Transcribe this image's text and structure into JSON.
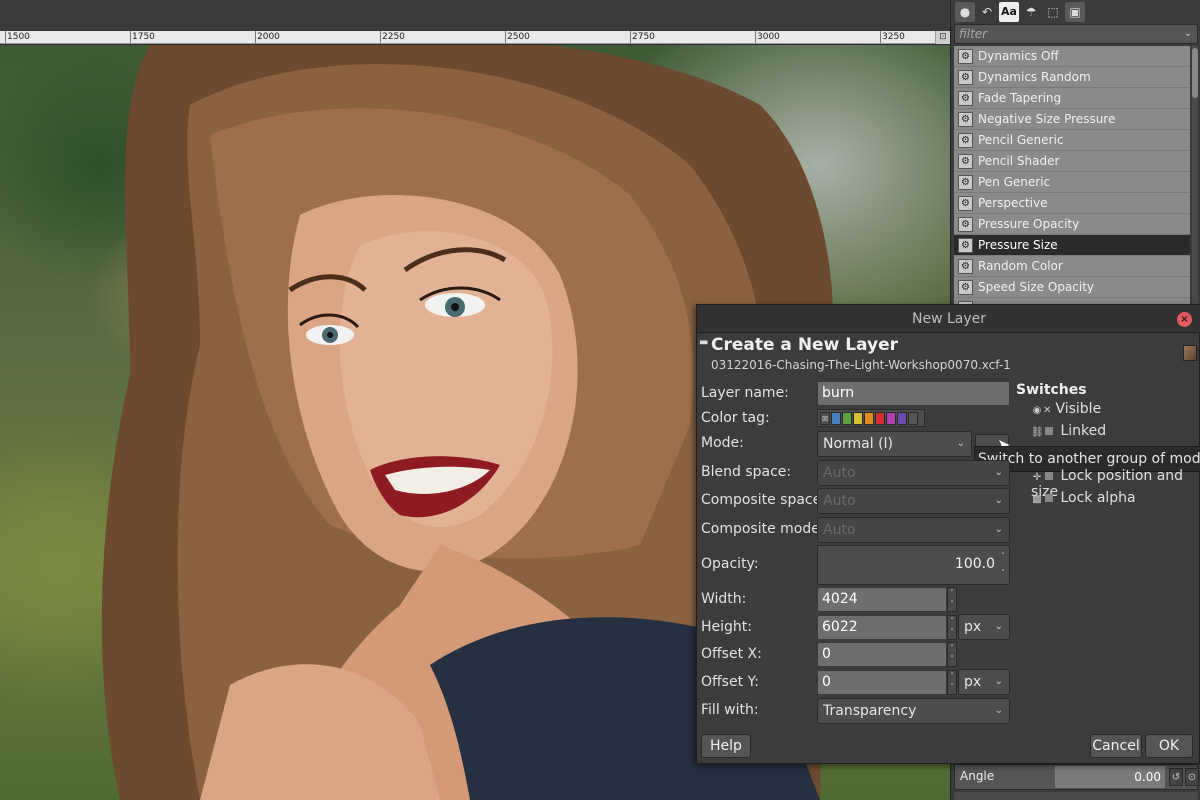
{
  "ruler": {
    "labels": [
      "1500",
      "1750",
      "2000",
      "2250",
      "2500",
      "2750",
      "3000",
      "3250"
    ],
    "corner_icon": "ruler-corner-icon"
  },
  "dock": {
    "tabs": [
      "brush-icon",
      "history-icon",
      "font-icon",
      "dynamics-icon",
      "tool-preset-icon",
      "paint-dynamics-icon"
    ],
    "tab_text": "Aa",
    "filter_placeholder": "filter",
    "dynamics": [
      "Dynamics Off",
      "Dynamics Random",
      "Fade Tapering",
      "Negative Size Pressure",
      "Pencil Generic",
      "Pencil Shader",
      "Pen Generic",
      "Perspective",
      "Pressure Opacity",
      "Pressure Size",
      "Random Color",
      "Speed Size Opacity"
    ],
    "selected_dynamic": "Pressure Size",
    "angle_label": "Angle",
    "angle_value": "0.00"
  },
  "dialog": {
    "window_title": "New Layer",
    "heading": "Create a New Layer",
    "subheading": "03122016-Chasing-The-Light-Workshop0070.xcf-1",
    "labels": {
      "layer_name": "Layer name:",
      "color_tag": "Color tag:",
      "mode": "Mode:",
      "blend_space": "Blend space:",
      "composite_space": "Composite space:",
      "composite_mode": "Composite mode:",
      "opacity": "Opacity:",
      "width": "Width:",
      "height": "Height:",
      "offset_x": "Offset X:",
      "offset_y": "Offset Y:",
      "fill_with": "Fill with:"
    },
    "values": {
      "layer_name": "burn",
      "mode": "Normal (l)",
      "blend_space": "Auto",
      "composite_space": "Auto",
      "composite_mode": "Auto",
      "opacity": "100.0",
      "width": "4024",
      "height": "6022",
      "offset_x": "0",
      "offset_y": "0",
      "size_unit": "px",
      "offset_unit": "px",
      "fill_with": "Transparency"
    },
    "color_tags": [
      "#8a8a8a",
      "#4a7fc0",
      "#5fa040",
      "#d4c030",
      "#e08a20",
      "#d03030",
      "#b040b0",
      "#6a4ab0",
      "#555555"
    ],
    "tooltip": "Switch to another group of modes",
    "switches": {
      "title": "Switches",
      "visible": "Visible",
      "linked": "Linked",
      "lock_position": "Lock position and size",
      "lock_alpha": "Lock alpha"
    },
    "buttons": {
      "help": "Help",
      "cancel": "Cancel",
      "ok": "OK"
    }
  }
}
